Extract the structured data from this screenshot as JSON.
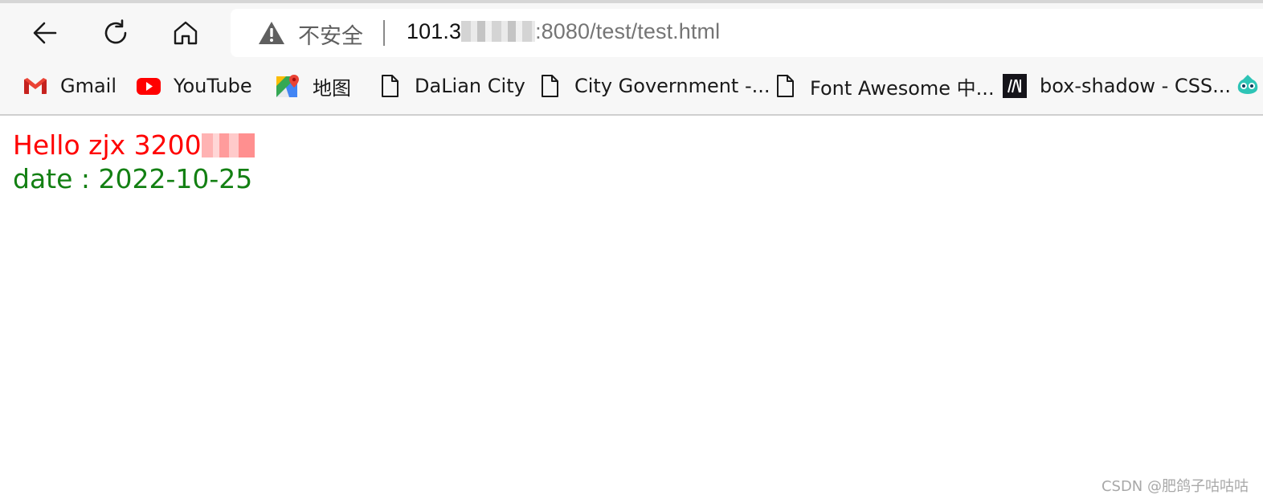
{
  "browser": {
    "toolbar": {
      "back_icon": "arrow-left-icon",
      "refresh_icon": "refresh-icon",
      "home_icon": "home-icon"
    },
    "address_bar": {
      "security_icon": "warning-triangle-icon",
      "security_label": "不安全",
      "url_host_prefix": "101.3",
      "url_path": ":8080/test/test.html"
    },
    "bookmarks": [
      {
        "label": "Gmail",
        "icon": "gmail-icon"
      },
      {
        "label": "YouTube",
        "icon": "youtube-icon"
      },
      {
        "label": "地图",
        "icon": "maps-icon"
      },
      {
        "label": "DaLian City",
        "icon": "document-icon"
      },
      {
        "label": "City Government -...",
        "icon": "document-icon"
      },
      {
        "label": "Font Awesome 中...",
        "icon": "document-icon"
      },
      {
        "label": "box-shadow - CSS...",
        "icon": "mdn-icon"
      },
      {
        "label": "",
        "icon": "bird-icon"
      }
    ]
  },
  "page": {
    "hello_text": "Hello zjx 3200",
    "date_text": "date : 2022-10-25",
    "hello_color": "#ff0000",
    "date_color": "#138013"
  },
  "watermark": "CSDN @肥鸽子咕咕咕"
}
